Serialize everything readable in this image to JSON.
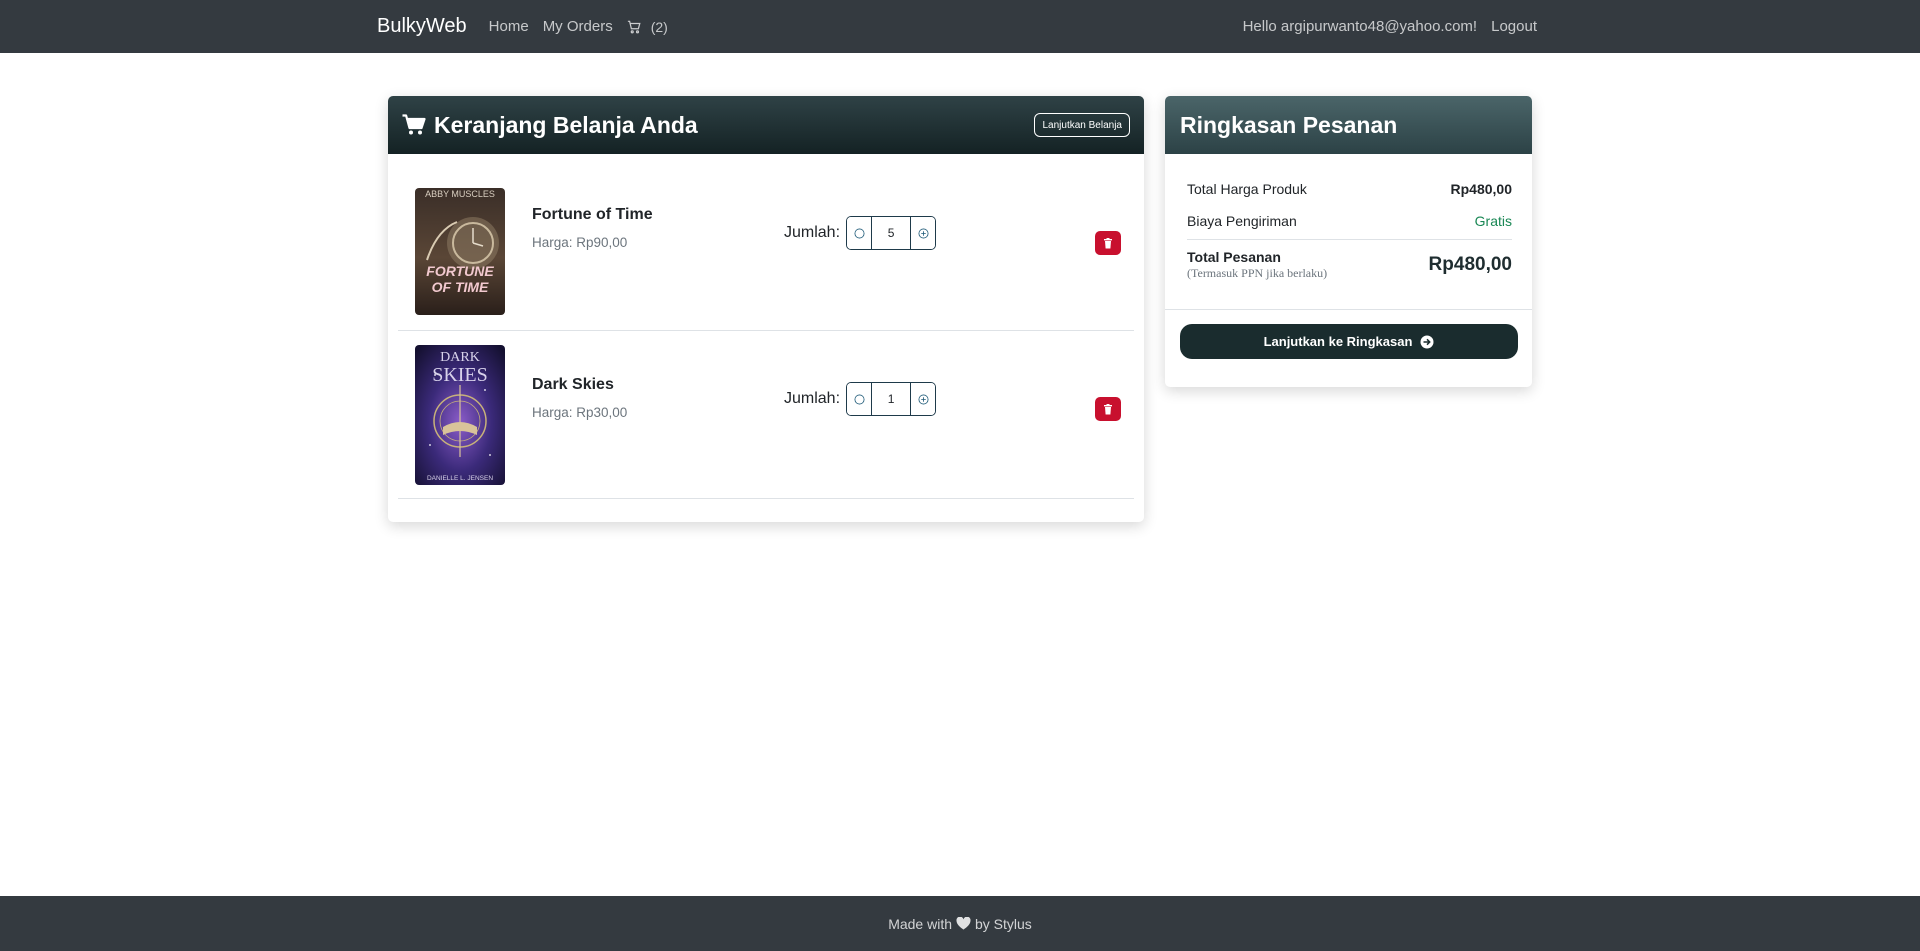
{
  "navbar": {
    "brand": "BulkyWeb",
    "links": [
      {
        "label": "Home"
      },
      {
        "label": "My Orders"
      }
    ],
    "cart_count": "(2)",
    "greeting": "Hello argipurwanto48@yahoo.com!",
    "logout": "Logout"
  },
  "cart": {
    "title": "Keranjang Belanja Anda",
    "continue_label": "Lanjutkan Belanja",
    "qty_label": "Jumlah:",
    "items": [
      {
        "title": "Fortune of Time",
        "price": "Harga: Rp90,00",
        "quantity": "5",
        "cover": {
          "author": "ABBY MUSCLES",
          "title_line1": "FORTUNE",
          "title_line2": "OF TIME"
        }
      },
      {
        "title": "Dark Skies",
        "price": "Harga: Rp30,00",
        "quantity": "1",
        "cover": {
          "title_line1": "DARK",
          "title_line2": "SKIES",
          "author": "DANIELLE L. JENSEN"
        }
      }
    ]
  },
  "summary": {
    "title": "Ringkasan Pesanan",
    "product_total_label": "Total Harga Produk",
    "product_total_value": "Rp480,00",
    "shipping_label": "Biaya Pengiriman",
    "shipping_value": "Gratis",
    "order_total_label": "Total Pesanan",
    "order_total_note": "(Termasuk PPN jika berlaku)",
    "order_total_value": "Rp480,00",
    "proceed_label": "Lanjutkan ke Ringkasan"
  },
  "footer": {
    "made_with": "Made with",
    "by": "by Stylus"
  },
  "colors": {
    "navbar_bg": "#343a40",
    "cart_header": "#142224",
    "summary_header": "#3e5a5e",
    "delete": "#c8102e",
    "free": "#198754"
  },
  "icons": {
    "cart_nav": "shopping-cart-icon",
    "cart_header": "shopping-cart-icon",
    "minus": "circle-minus-icon",
    "plus": "circle-plus-icon",
    "delete": "trash-icon",
    "proceed": "arrow-right-circle-icon",
    "heart": "heart-icon"
  }
}
